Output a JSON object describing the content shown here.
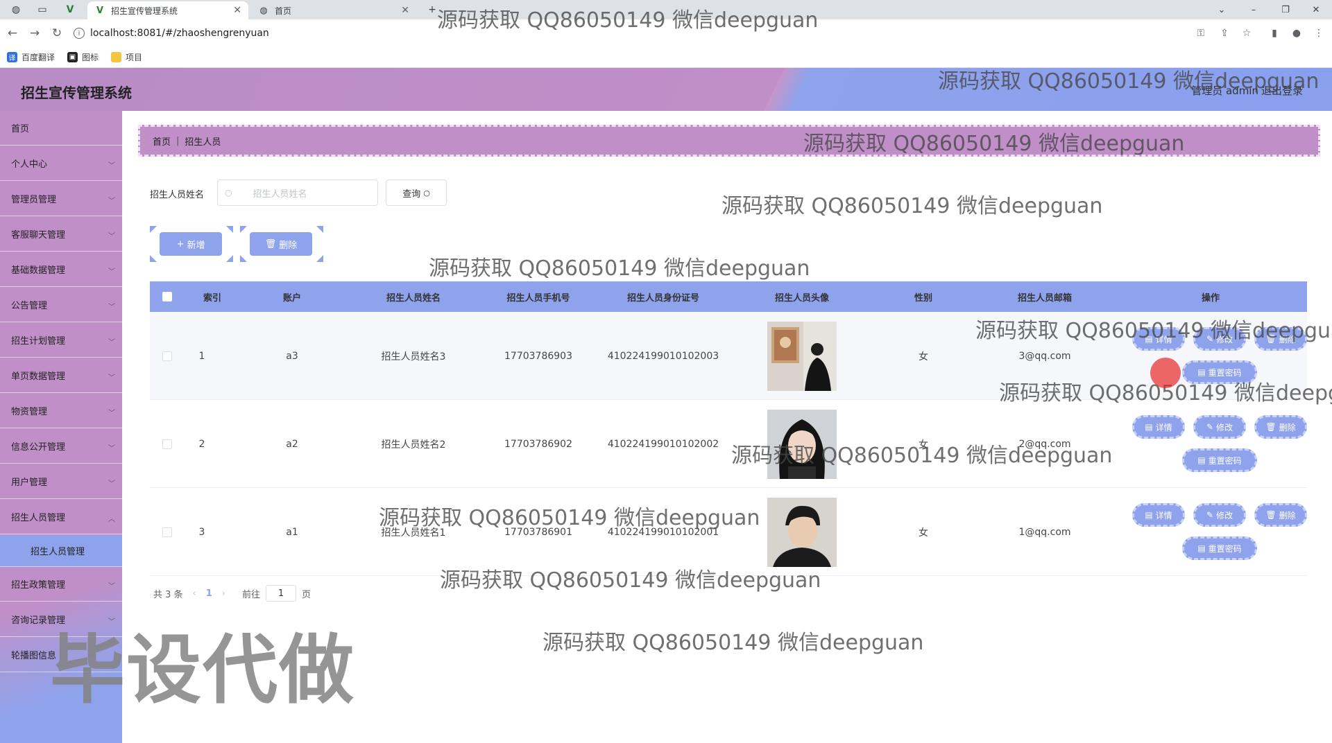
{
  "browser": {
    "tabs": [
      {
        "title": "招生宣传管理系统",
        "active": true
      },
      {
        "title": "首页",
        "active": false
      }
    ],
    "url": "localhost:8081/#/zhaoshengrenyuan",
    "bookmarks": [
      "百度翻译",
      "图标",
      "项目"
    ]
  },
  "header": {
    "title": "招生宣传管理系统",
    "user": "管理员 admin",
    "logout": "退出登录"
  },
  "sidebar": {
    "items": [
      {
        "label": "首页",
        "expandable": false
      },
      {
        "label": "个人中心",
        "expandable": true
      },
      {
        "label": "管理员管理",
        "expandable": true
      },
      {
        "label": "客服聊天管理",
        "expandable": true
      },
      {
        "label": "基础数据管理",
        "expandable": true
      },
      {
        "label": "公告管理",
        "expandable": true
      },
      {
        "label": "招生计划管理",
        "expandable": true
      },
      {
        "label": "单页数据管理",
        "expandable": true
      },
      {
        "label": "物资管理",
        "expandable": true
      },
      {
        "label": "信息公开管理",
        "expandable": true
      },
      {
        "label": "用户管理",
        "expandable": true
      },
      {
        "label": "招生人员管理",
        "expandable": true
      }
    ],
    "sub_item": "招生人员管理",
    "items_after": [
      {
        "label": "招生政策管理",
        "expandable": true
      },
      {
        "label": "咨询记录管理",
        "expandable": true
      },
      {
        "label": "轮播图信息",
        "expandable": false
      }
    ]
  },
  "breadcrumb": {
    "home": "首页",
    "current": "招生人员"
  },
  "search": {
    "label": "招生人员姓名",
    "placeholder": "招生人员姓名",
    "button": "查询"
  },
  "actions": {
    "add": "新增",
    "delete": "删除"
  },
  "table": {
    "columns": [
      "索引",
      "账户",
      "招生人员姓名",
      "招生人员手机号",
      "招生人员身份证号",
      "招生人员头像",
      "性别",
      "招生人员邮箱",
      "操作"
    ],
    "rows": [
      {
        "index": "1",
        "account": "a3",
        "name": "招生人员姓名3",
        "phone": "17703786903",
        "id_card": "410224199010102003",
        "avatar": "avatar-gallery-photo",
        "gender": "女",
        "email": "3@qq.com"
      },
      {
        "index": "2",
        "account": "a2",
        "name": "招生人员姓名2",
        "phone": "17703786902",
        "id_card": "410224199010102002",
        "avatar": "avatar-woman-photo",
        "gender": "女",
        "email": "2@qq.com"
      },
      {
        "index": "3",
        "account": "a1",
        "name": "招生人员姓名1",
        "phone": "17703786901",
        "id_card": "410224199010102001",
        "avatar": "avatar-man-photo",
        "gender": "女",
        "email": "1@qq.com"
      }
    ],
    "row_actions": {
      "detail": "详情",
      "edit": "修改",
      "delete": "删除",
      "reset": "重置密码"
    }
  },
  "pagination": {
    "total": "共 3 条",
    "current": "1",
    "goto": "前往",
    "page_input": "1",
    "page_suffix": "页"
  },
  "watermark": {
    "text": "源码获取 QQ86050149 微信deepguan",
    "big": "毕设代做"
  },
  "colors": {
    "primary": "#8fa2ec",
    "header_purple": "#c08fc8"
  }
}
